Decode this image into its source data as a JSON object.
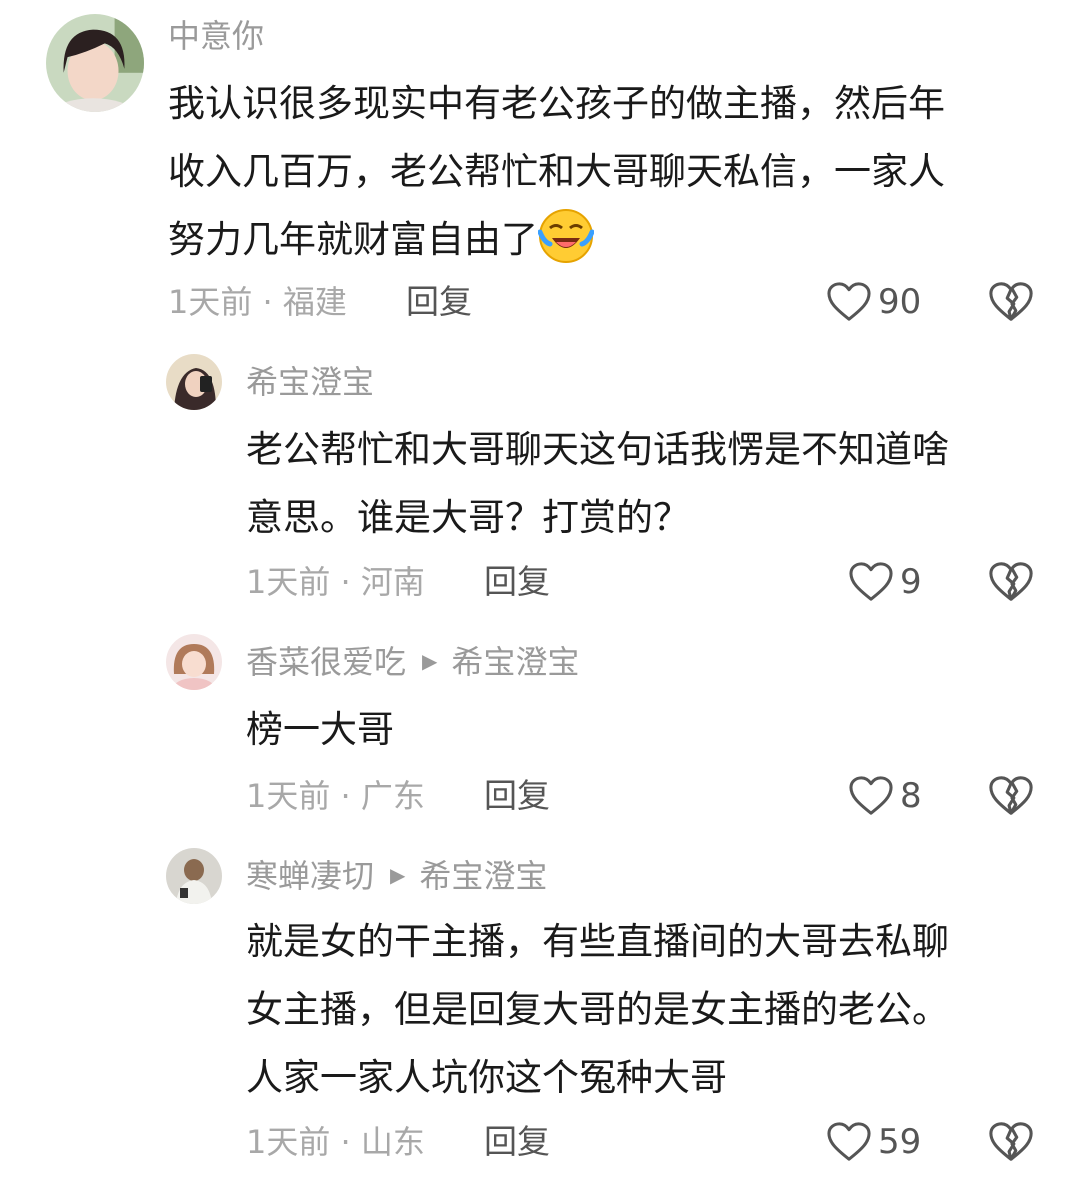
{
  "comments": [
    {
      "username": "中意你",
      "lines": [
        "我认识很多现实中有老公孩子的做主播，然后年",
        "收入几百万，老公帮忙和大哥聊天私信，一家人",
        "努力几年就财富自由了"
      ],
      "emoji": "laughing-crying-emoji",
      "time_location": "1天前 · 福建",
      "reply_label": "回复",
      "likes": "90"
    },
    {
      "username": "希宝澄宝",
      "lines": [
        "老公帮忙和大哥聊天这句话我愣是不知道啥",
        "意思。谁是大哥？打赏的？"
      ],
      "time_location": "1天前 · 河南",
      "reply_label": "回复",
      "likes": "9"
    },
    {
      "username": "香菜很爱吃",
      "reply_to": "希宝澄宝",
      "lines": [
        "榜一大哥"
      ],
      "time_location": "1天前 · 广东",
      "reply_label": "回复",
      "likes": "8"
    },
    {
      "username": "寒蝉凄切",
      "reply_to": "希宝澄宝",
      "lines": [
        "就是女的干主播，有些直播间的大哥去私聊",
        "女主播，但是回复大哥的是女主播的老公。",
        "人家一家人坑你这个冤种大哥"
      ],
      "time_location": "1天前 · 山东",
      "reply_label": "回复",
      "likes": "59"
    }
  ],
  "icons": {
    "like": "heart-outline-icon",
    "dislike": "broken-heart-icon",
    "reply_arrow": "triangle-right-icon"
  }
}
